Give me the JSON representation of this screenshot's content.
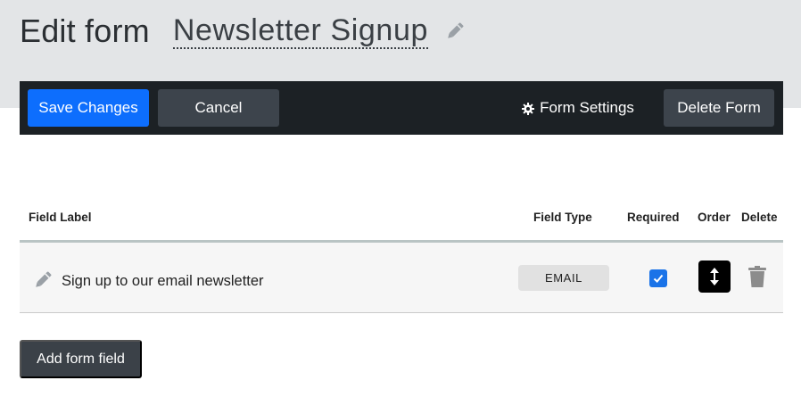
{
  "header": {
    "page_title": "Edit form",
    "form_name": "Newsletter Signup",
    "edit_icon": "pencil-icon"
  },
  "toolbar": {
    "save_label": "Save Changes",
    "cancel_label": "Cancel",
    "settings_label": "Form Settings",
    "settings_icon": "gear-icon",
    "delete_label": "Delete Form"
  },
  "table": {
    "headers": {
      "field_label": "Field Label",
      "field_type": "Field Type",
      "required": "Required",
      "order": "Order",
      "delete": "Delete"
    },
    "rows": [
      {
        "label": "Sign up to our email newsletter",
        "type": "EMAIL",
        "required": true,
        "order_icon": "vertical-arrows-icon",
        "delete_icon": "trash-icon"
      }
    ]
  },
  "footer": {
    "add_field_label": "Add form field"
  },
  "colors": {
    "header_band": "#e3e5e7",
    "toolbar_bg": "#1c2125",
    "primary": "#0d6efd",
    "secondary_button": "#3d444c",
    "checkbox": "#1a73e8"
  }
}
